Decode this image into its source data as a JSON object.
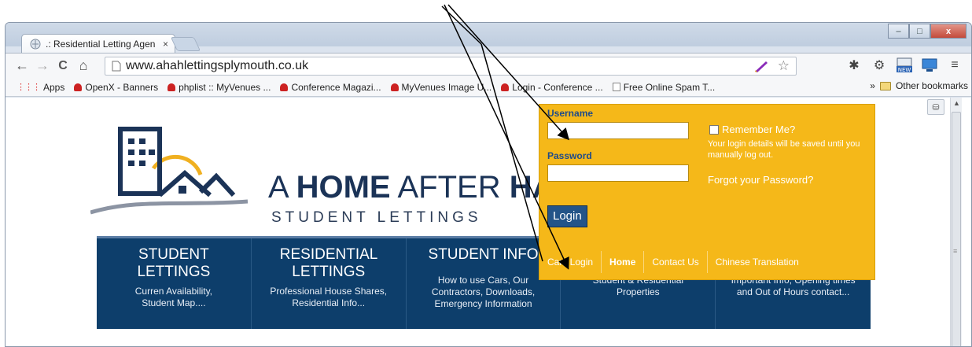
{
  "browser": {
    "tab_title": ".: Residential Letting Agen",
    "tab_close": "×",
    "url": "www.ahahlettingsplymouth.co.uk",
    "nav": {
      "back": "←",
      "forward": "→",
      "reload": "C",
      "home": "⌂"
    },
    "window_buttons": {
      "minimize": "–",
      "maximize": "□",
      "close": "x"
    }
  },
  "bookmarks": {
    "items": [
      {
        "label": "Apps"
      },
      {
        "label": "OpenX - Banners"
      },
      {
        "label": "phplist :: MyVenues ..."
      },
      {
        "label": "Conference Magazi..."
      },
      {
        "label": "MyVenues Image U..."
      },
      {
        "label": "Login - Conference ..."
      },
      {
        "label": "Free Online Spam T..."
      }
    ],
    "overflow": "»",
    "other": "Other bookmarks"
  },
  "site": {
    "brand": {
      "pre": "A ",
      "bold": "HOME",
      "mid": " AFTER ",
      "bold2": "HA"
    },
    "tagline": "STUDENT LETTINGS",
    "nav": [
      {
        "title": "STUDENT LETTINGS",
        "sub": "Curren Availability, Student Map...."
      },
      {
        "title": "RESIDENTIAL LETTINGS",
        "sub": "Professional House Shares, Residential Info..."
      },
      {
        "title": "STUDENT INFO",
        "sub": "How to use Cars, Our Contractors, Downloads, Emergency Information"
      },
      {
        "title": "",
        "sub": "Student & Residential Properties"
      },
      {
        "title": "",
        "sub": "Important Info, Opening times and Out of Hours contact..."
      }
    ]
  },
  "login": {
    "username_label": "Username",
    "password_label": "Password",
    "remember_label": "Remember Me?",
    "remember_note": "Your login details will be saved until you manually log out.",
    "forgot_label": "Forgot your Password?",
    "button_label": "Login",
    "links": [
      {
        "label": "Cars Login",
        "active": false
      },
      {
        "label": "Home",
        "active": true
      },
      {
        "label": "Contact Us",
        "active": false
      },
      {
        "label": "Chinese Translation",
        "active": false
      }
    ]
  },
  "colors": {
    "login_panel": "#f5b819",
    "navbar": "#0d3e6b",
    "brand": "#1b3357",
    "login_button": "#235488"
  }
}
